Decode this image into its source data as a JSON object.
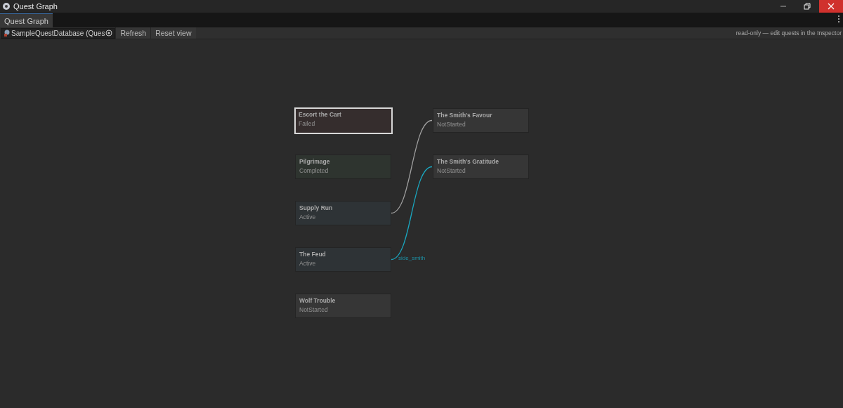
{
  "window": {
    "title": "Quest Graph"
  },
  "tabs": [
    {
      "label": "Quest Graph",
      "selected": true
    }
  ],
  "toolbar": {
    "database_field": {
      "value": "SampleQuestDatabase (Ques"
    },
    "buttons": [
      "Refresh",
      "Reset view"
    ],
    "hint": "read-only — edit quests in the Inspector"
  },
  "graph": {
    "columns": [
      [
        {
          "title": "Escort the Cart",
          "status": "Failed",
          "color": "#352d2d",
          "selected": true
        },
        {
          "title": "Pilgrimage",
          "status": "Completed",
          "color": "#2e342f",
          "selected": false
        },
        {
          "title": "Supply Run",
          "status": "Active",
          "color": "#2e3336",
          "selected": false,
          "link": {
            "color": "#a0a0a0"
          }
        },
        {
          "title": "The Feud",
          "status": "Active",
          "color": "#2e3336",
          "selected": false,
          "link": {
            "color": "#1aa7c0",
            "label": "side_smith"
          }
        },
        {
          "title": "Wolf Trouble",
          "status": "NotStarted",
          "color": "#363636",
          "selected": false
        }
      ],
      [
        {
          "title": "The Smith's Favour",
          "status": "NotStarted",
          "color": "#363636",
          "selected": false
        },
        {
          "title": "The Smith's Gratitude",
          "status": "NotStarted",
          "color": "#363636",
          "selected": false
        }
      ]
    ]
  }
}
